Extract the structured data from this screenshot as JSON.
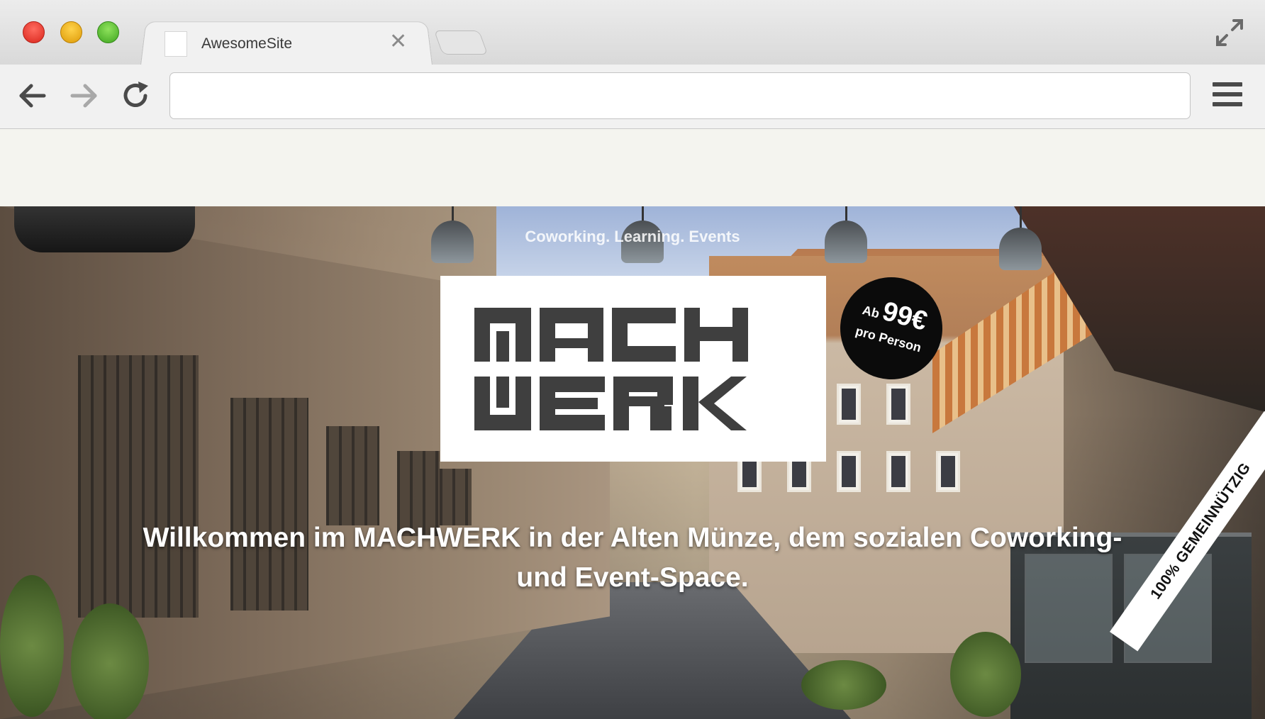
{
  "browser": {
    "tab_title": "AwesomeSite",
    "tab_close_icon": "close-icon",
    "url": "",
    "icons": {
      "back": "arrow-left-icon",
      "forward": "arrow-right-icon",
      "reload": "reload-icon",
      "menu": "hamburger-menu-icon",
      "fullscreen": "fullscreen-icon"
    },
    "colors": {
      "close": "#ff5f57",
      "minimize": "#febc2e",
      "zoom": "#28c840"
    }
  },
  "hero": {
    "tagline": "Coworking. Learning. Events",
    "logo_text": "MACHWERK",
    "badge": {
      "prefix": "Ab",
      "price": "99€",
      "suffix": "pro Person"
    },
    "headline": "Willkommen im MACHWERK in der Alten Münze, dem sozialen Coworking- und Event-Space.",
    "ribbon": "100% GEMEINNÜTZIG"
  }
}
